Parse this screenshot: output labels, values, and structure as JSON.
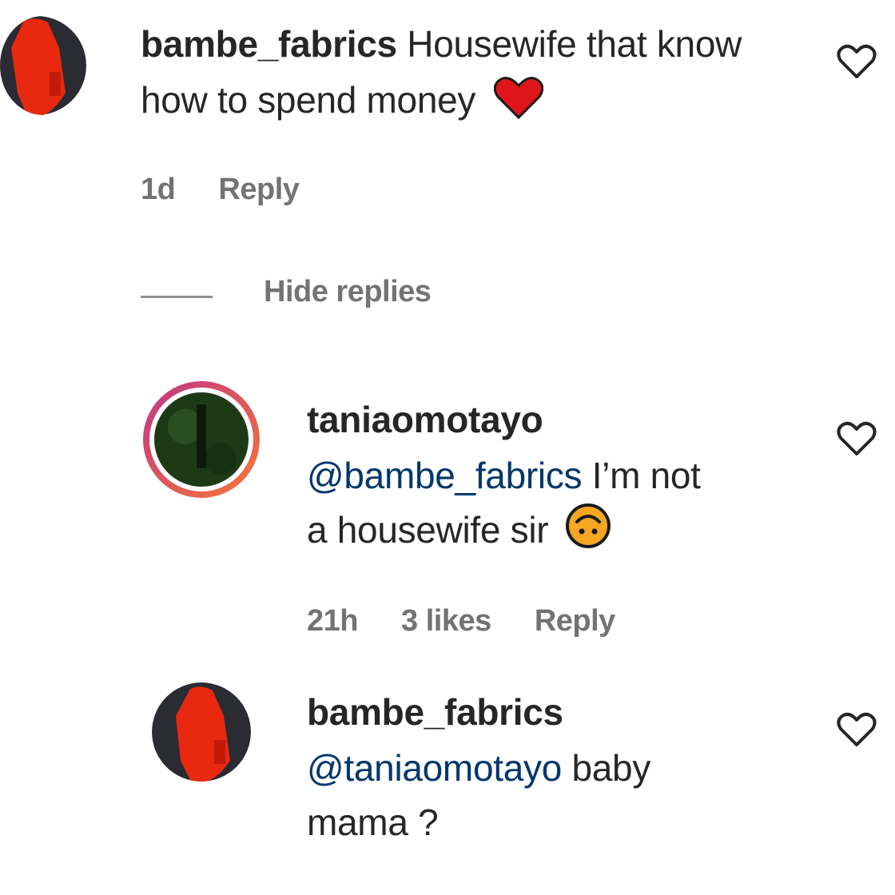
{
  "comments": [
    {
      "username": "bambe_fabrics",
      "text": "Housewife that know how to spend money",
      "emoji_icon": "red-heart-icon",
      "time": "1d",
      "reply_label": "Reply"
    },
    {
      "username": "taniaomotayo",
      "mention": "@bambe_fabrics",
      "text_line1": "I’m not",
      "text_line2": "a housewife sir",
      "emoji_icon": "upside-down-face-icon",
      "time": "21h",
      "likes": "3 likes",
      "reply_label": "Reply"
    },
    {
      "username": "bambe_fabrics",
      "mention": "@taniaomotayo",
      "text_line1": "baby",
      "text_line2": "mama ?"
    }
  ],
  "hide_replies_label": "Hide replies",
  "colors": {
    "text": "#262626",
    "mention": "#00376b",
    "meta": "#737373",
    "heart_emoji": "#e0151b",
    "avatar_story_ring_start": "#c13584",
    "avatar_story_ring_end": "#f77737"
  }
}
